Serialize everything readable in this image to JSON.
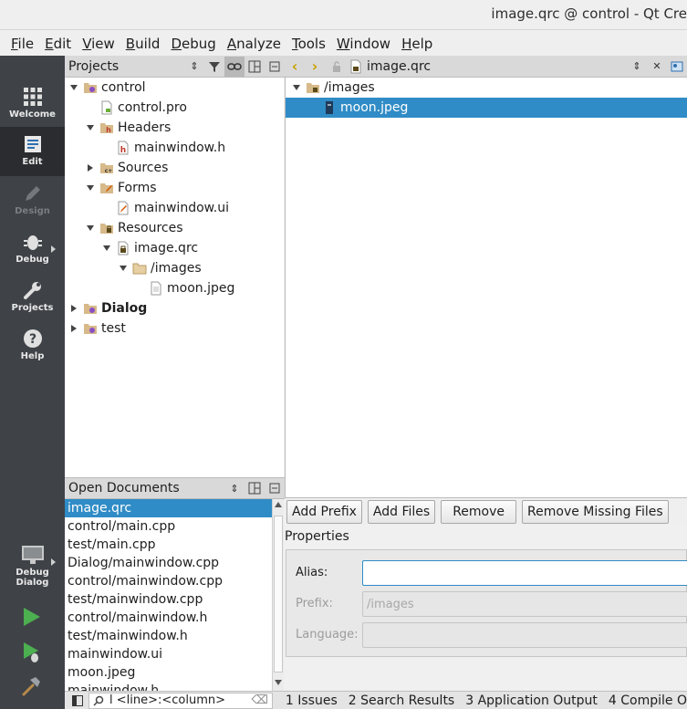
{
  "window": {
    "title": "image.qrc @ control - Qt Cre"
  },
  "menu": [
    {
      "label": "File",
      "mn": "F",
      "rest": "ile"
    },
    {
      "label": "Edit",
      "mn": "E",
      "rest": "dit"
    },
    {
      "label": "View",
      "mn": "V",
      "rest": "iew"
    },
    {
      "label": "Build",
      "mn": "B",
      "rest": "uild"
    },
    {
      "label": "Debug",
      "mn": "D",
      "rest": "ebug"
    },
    {
      "label": "Analyze",
      "mn": "A",
      "rest": "nalyze"
    },
    {
      "label": "Tools",
      "mn": "T",
      "rest": "ools"
    },
    {
      "label": "Window",
      "mn": "W",
      "rest": "indow"
    },
    {
      "label": "Help",
      "mn": "H",
      "rest": "elp"
    }
  ],
  "modes": {
    "welcome": "Welcome",
    "edit": "Edit",
    "design": "Design",
    "debug": "Debug",
    "projects": "Projects",
    "help": "Help"
  },
  "kit": {
    "label": "Dialog",
    "mode": "Debug"
  },
  "projects": {
    "title": "Projects",
    "tree": [
      "control",
      "control.pro",
      "Headers",
      "mainwindow.h",
      "Sources",
      "Forms",
      "mainwindow.ui",
      "Resources",
      "image.qrc",
      "/images",
      "moon.jpeg",
      "Dialog",
      "test"
    ]
  },
  "open_documents": {
    "title": "Open Documents",
    "items": [
      "image.qrc",
      "control/main.cpp",
      "test/main.cpp",
      "Dialog/mainwindow.cpp",
      "control/mainwindow.cpp",
      "test/mainwindow.cpp",
      "control/mainwindow.h",
      "test/mainwindow.h",
      "mainwindow.ui",
      "moon.jpeg",
      "mainwindow.h"
    ]
  },
  "editor": {
    "file": "image.qrc",
    "prefix": "/images",
    "selected": "moon.jpeg"
  },
  "buttons": {
    "add_prefix": "Add Prefix",
    "add_files": "Add Files",
    "remove": "Remove",
    "remove_missing": "Remove Missing Files"
  },
  "properties": {
    "title": "Properties",
    "alias_label": "Alias:",
    "alias_value": "",
    "prefix_label": "Prefix:",
    "prefix_value": "/images",
    "language_label": "Language:",
    "language_value": ""
  },
  "status": {
    "locator_placeholder": "l <line>:<column>",
    "panes": [
      "1  Issues",
      "2  Search Results",
      "3  Application Output",
      "4  Compile O"
    ]
  },
  "colors": {
    "selection": "#308cc6",
    "modebar": "#3f4348",
    "run": "#4caf50"
  }
}
